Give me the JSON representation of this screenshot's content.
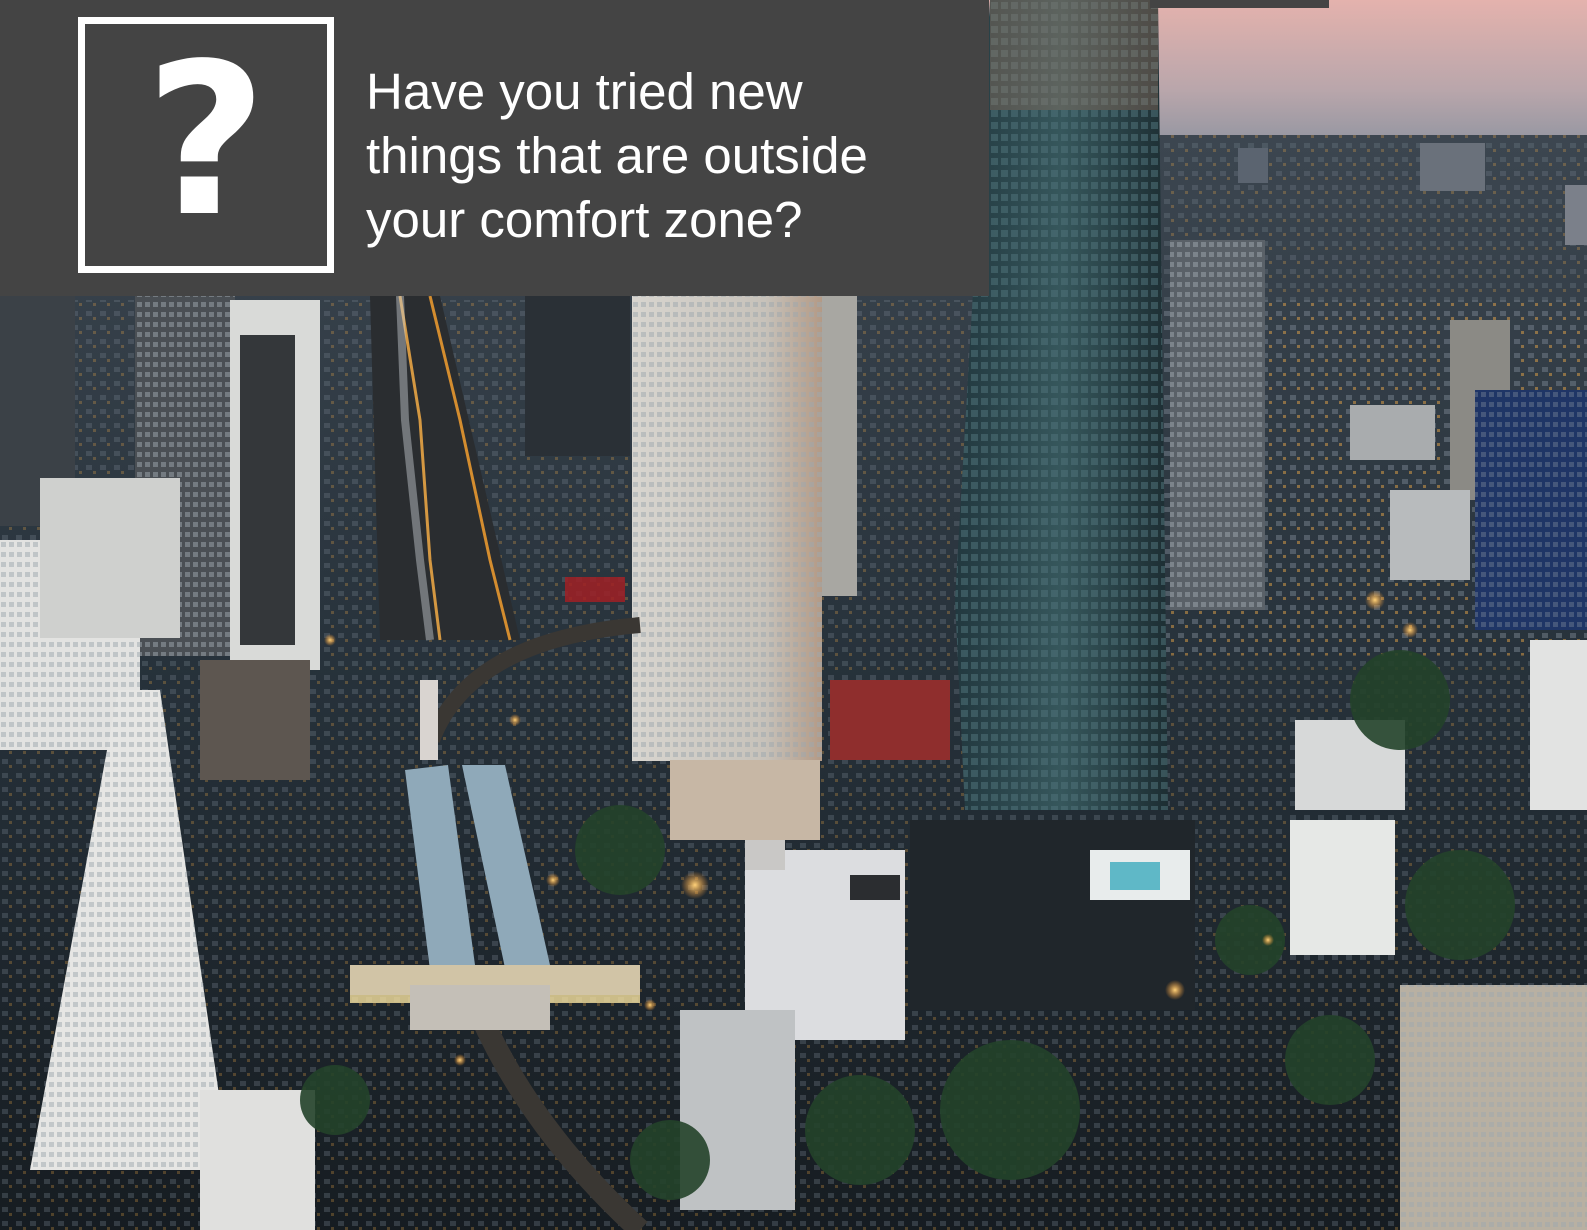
{
  "photo": {
    "subject": "aerial-city-dusk",
    "colors": {
      "sky_top": "#e7b7b4",
      "sky_bottom": "#8b8fa0",
      "city_dark": "#1f2a33",
      "tower_glass": "#2c4a52",
      "light": "#ffb347"
    }
  },
  "banner": {
    "background": "#444444",
    "icon": "question-mark-icon",
    "icon_glyph": "?",
    "question_lines": [
      "Have you tried new",
      "things that are outside",
      "your comfort zone?"
    ]
  }
}
